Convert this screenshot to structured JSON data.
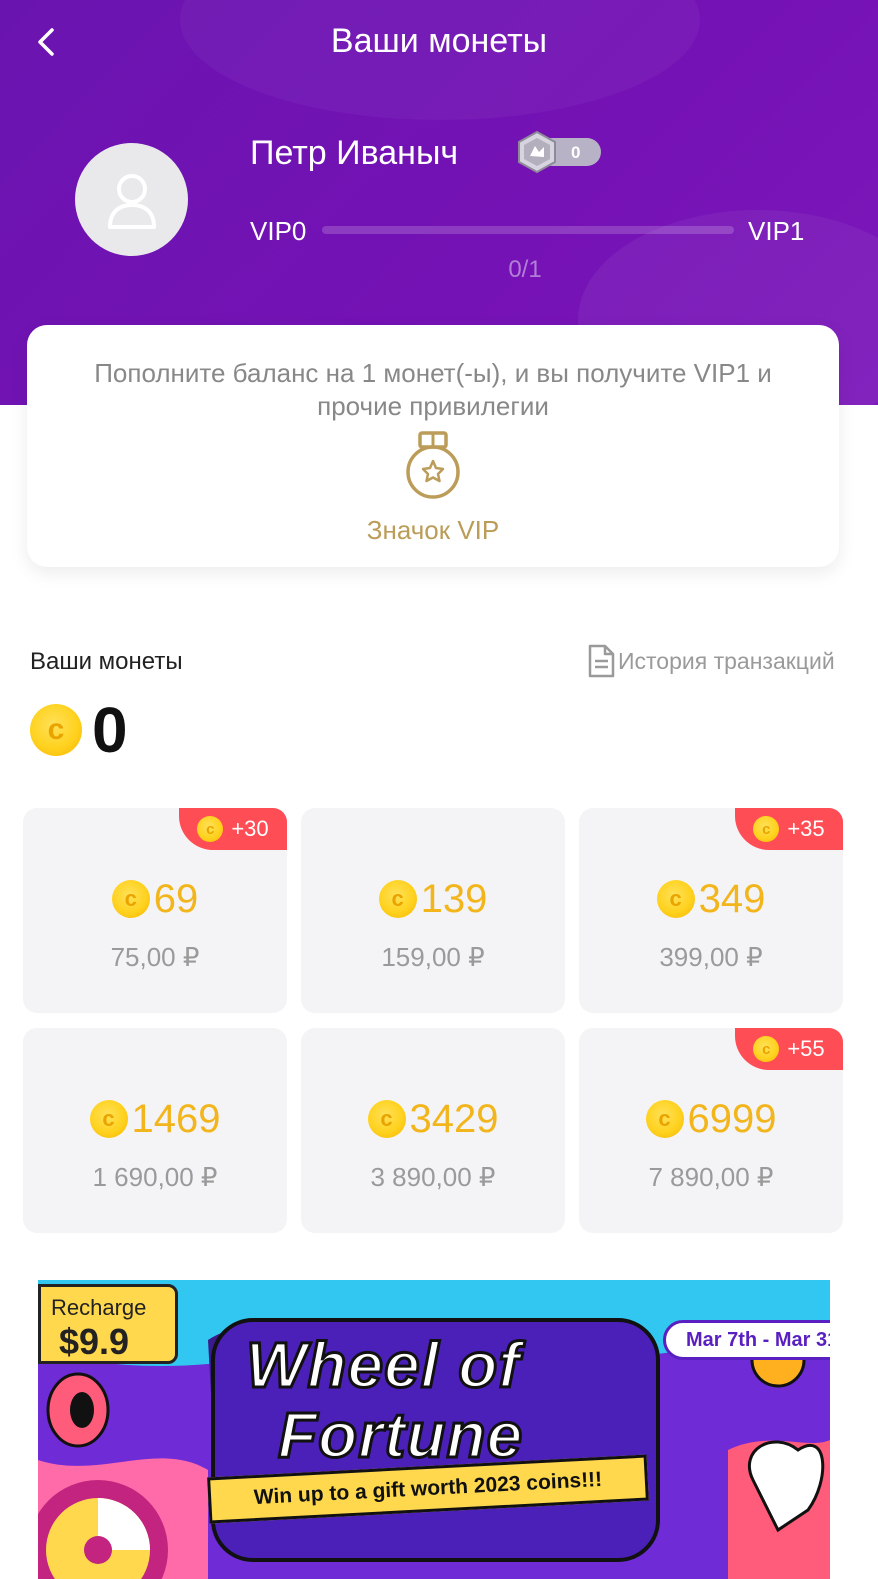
{
  "header": {
    "title": "Ваши монеты",
    "back_icon": "chevron-left-icon"
  },
  "profile": {
    "name": "Петр Иваныч",
    "level_value": "0",
    "vip_current": "VIP0",
    "vip_next": "VIP1",
    "progress_text": "0/1",
    "progress_fraction": 0
  },
  "vip_card": {
    "message": "Пополните баланс на 1 монет(-ы), и вы получите VIP1 и прочие привилегии",
    "perk_label": "Значок VIP",
    "perk_icon": "medal-icon"
  },
  "wallet": {
    "label": "Ваши монеты",
    "history_label": "История транзакций",
    "balance": "0"
  },
  "packs": [
    {
      "amount": "69",
      "price": "75,00 ₽",
      "bonus": "+30"
    },
    {
      "amount": "139",
      "price": "159,00 ₽",
      "bonus": ""
    },
    {
      "amount": "349",
      "price": "399,00 ₽",
      "bonus": "+35"
    },
    {
      "amount": "1469",
      "price": "1 690,00 ₽",
      "bonus": ""
    },
    {
      "amount": "3429",
      "price": "3 890,00 ₽",
      "bonus": ""
    },
    {
      "amount": "6999",
      "price": "7 890,00 ₽",
      "bonus": "+55"
    }
  ],
  "banner": {
    "recharge_line1": "Recharge",
    "recharge_line2": "$9.9",
    "dates": "Mar 7th - Mar 31",
    "title_line1": "Wheel of",
    "title_line2": "Fortune",
    "subtitle": "Win up to a gift worth 2023 coins!!!"
  },
  "colors": {
    "header_purple": "#7512b5",
    "coin_gold": "#f2b51c",
    "bonus_red": "#ff4d55",
    "vip_gold": "#bb9c58"
  }
}
